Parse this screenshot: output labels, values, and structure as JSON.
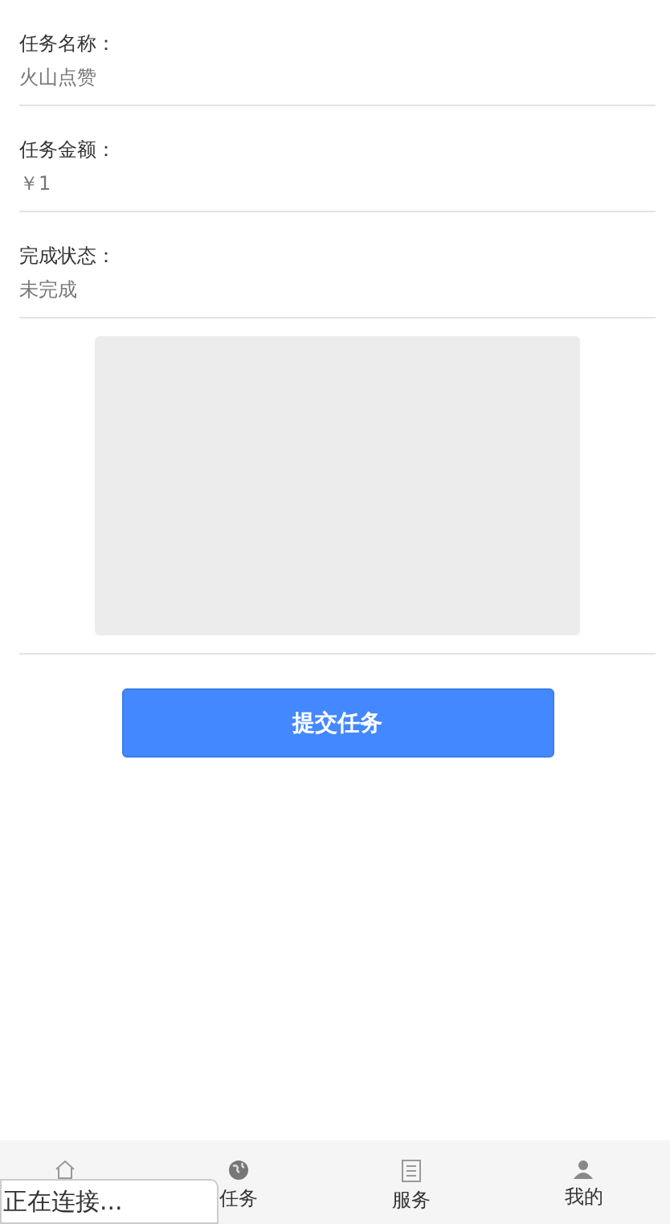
{
  "fields": [
    {
      "label": "任务名称：",
      "value": "火山点赞"
    },
    {
      "label": "任务金额：",
      "value": "￥1"
    },
    {
      "label": "完成状态：",
      "value": "未完成"
    }
  ],
  "submit_button": "提交任务",
  "tabs": [
    {
      "kind": "home"
    },
    {
      "kind": "task",
      "label": "任务"
    },
    {
      "kind": "service",
      "label": "服务"
    },
    {
      "kind": "profile",
      "label": "我的"
    }
  ],
  "toast": "正在连接..."
}
